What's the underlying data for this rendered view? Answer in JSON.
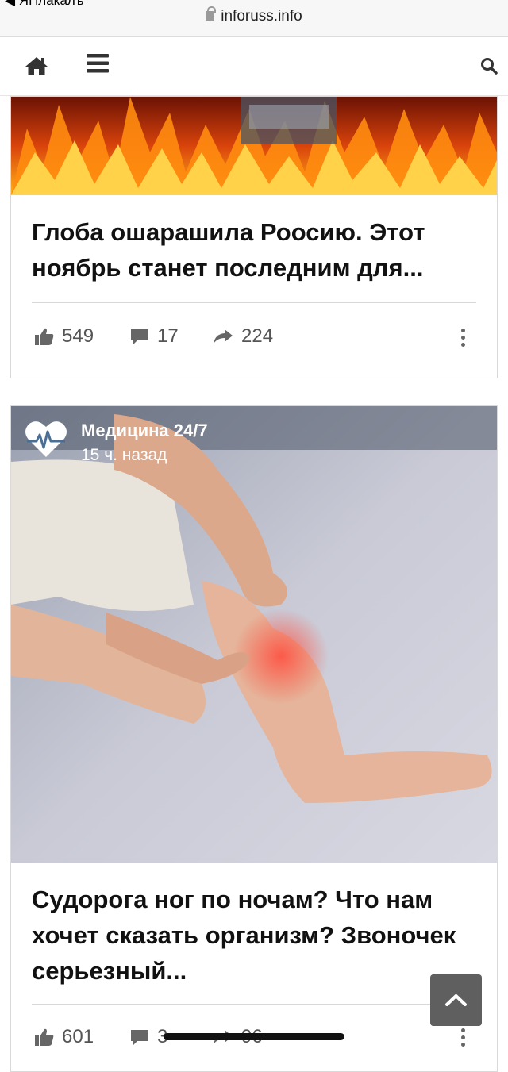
{
  "browser": {
    "back_app_label": "◀ ЯПлакалъ",
    "url": "inforuss.info"
  },
  "nav": {
    "home_icon": "home-icon",
    "menu_icon": "hamburger-menu-icon",
    "search_icon": "search-icon"
  },
  "articles": [
    {
      "title": "Глоба ошарашила Роосию. Этот ноябрь станет последним для...",
      "likes": "549",
      "comments": "17",
      "shares": "224"
    },
    {
      "source_name": "Медицина 24/7",
      "source_time": "15 ч. назад",
      "title": "Судорога ног по ночам? Что нам хочет сказать организм? Звоночек серьезный...",
      "likes": "601",
      "comments": "3",
      "shares": "96"
    }
  ],
  "colors": {
    "accent_dark": "#333333",
    "stat_text": "#555555",
    "scroll_button": "#5f5f5f"
  }
}
